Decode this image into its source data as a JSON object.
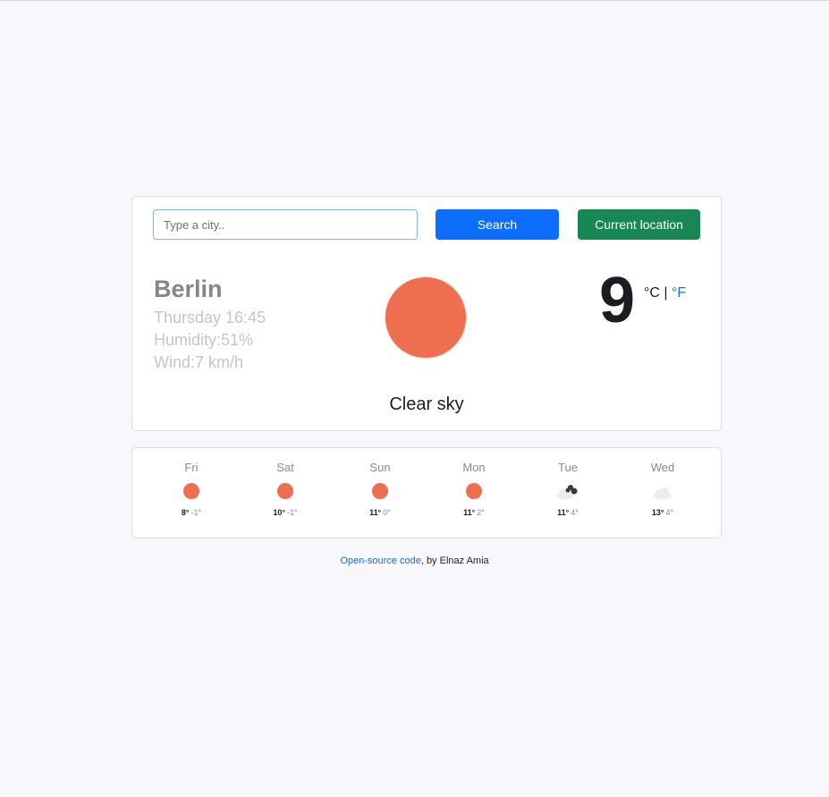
{
  "search": {
    "placeholder": "Type a city..",
    "value": "",
    "search_label": "Search",
    "location_label": "Current location"
  },
  "current": {
    "city": "Berlin",
    "datetime": "Thursday 16:45",
    "humidity": "Humidity:51%",
    "wind": "Wind:7 km/h",
    "icon": "sun-icon",
    "temperature": "9",
    "unit_c": "°C",
    "unit_sep": " | ",
    "unit_f": "°F",
    "description": "Clear sky"
  },
  "forecast": [
    {
      "day": "Fri",
      "max": "8°",
      "min": "-1°",
      "icon": "sun-icon"
    },
    {
      "day": "Sat",
      "max": "10°",
      "min": "-1°",
      "icon": "sun-icon"
    },
    {
      "day": "Sun",
      "max": "11°",
      "min": "0°",
      "icon": "sun-icon"
    },
    {
      "day": "Mon",
      "max": "11°",
      "min": "2°",
      "icon": "sun-icon"
    },
    {
      "day": "Tue",
      "max": "11°",
      "min": "4°",
      "icon": "cloud-dark-icon"
    },
    {
      "day": "Wed",
      "max": "13°",
      "min": "4°",
      "icon": "cloud-icon"
    }
  ],
  "footer": {
    "link_text": "Open-source code",
    "suffix": ", by Elnaz Amia"
  },
  "colors": {
    "sun": "#ed6f4f",
    "primary": "#0d6efd",
    "success": "#198754",
    "background": "#f7f7fc"
  }
}
